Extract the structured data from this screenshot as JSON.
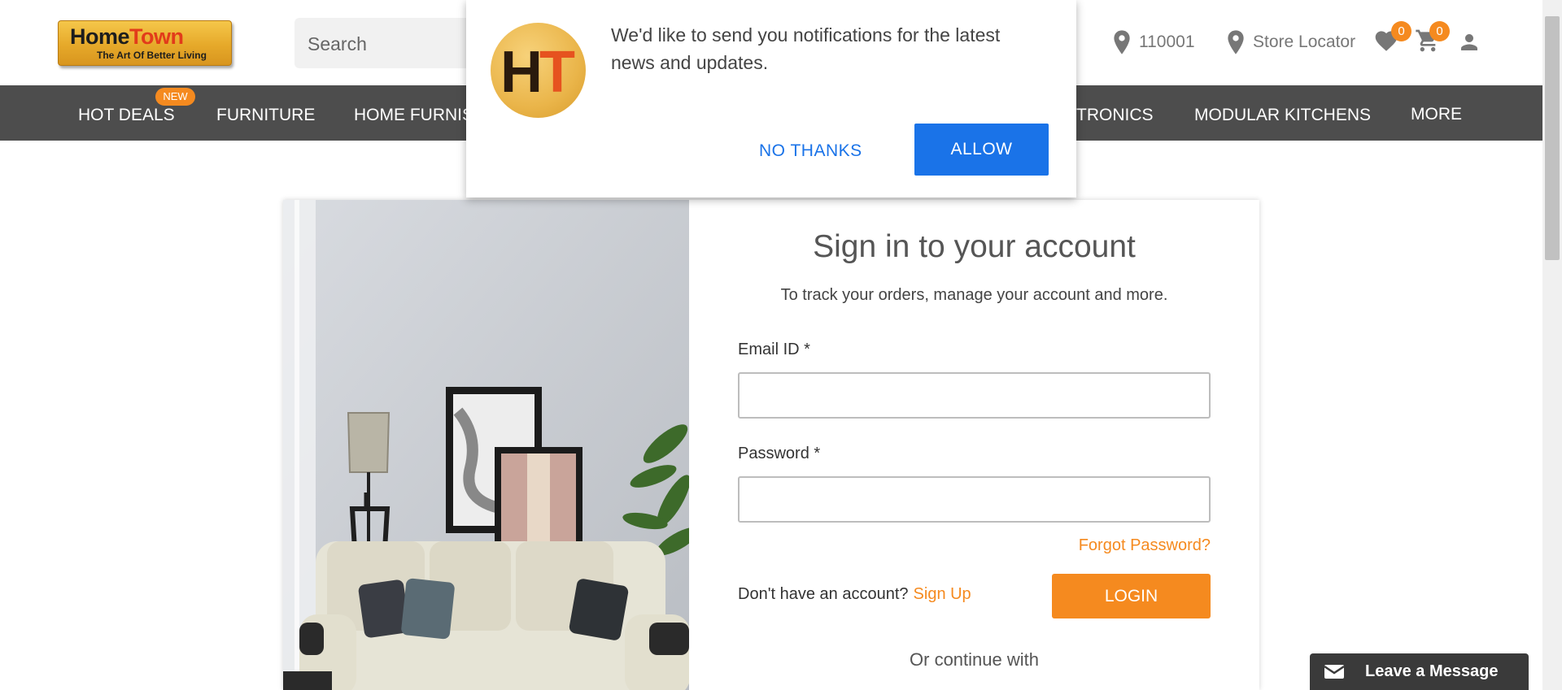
{
  "header": {
    "logo_main_home": "Home",
    "logo_main_town": "Town",
    "logo_tagline": "The Art Of Better Living",
    "search_placeholder": "Search",
    "pincode": "110001",
    "store_locator": "Store Locator",
    "wishlist_count": "0",
    "cart_count": "0",
    "icons": [
      "location-pin-icon",
      "heart-icon",
      "cart-icon",
      "user-icon"
    ]
  },
  "nav": {
    "items": [
      "HOT DEALS",
      "FURNITURE",
      "HOME FURNIS",
      "TRONICS",
      "MODULAR KITCHENS",
      "MORE"
    ],
    "new_badge": "NEW"
  },
  "login": {
    "title": "Sign in to your account",
    "subtitle": "To track your orders, manage your account and more.",
    "email_label": "Email ID *",
    "password_label": "Password *",
    "forgot": "Forgot Password?",
    "no_account": "Don't have an account?",
    "signup": "Sign Up",
    "login_button": "LOGIN",
    "or_continue": "Or continue with"
  },
  "notification": {
    "logo_h": "H",
    "logo_t": "T",
    "text": "We'd like to send you notifications for the latest news and updates.",
    "no_thanks": "NO THANKS",
    "allow": "ALLOW"
  },
  "chat": {
    "label": "Leave a Message"
  },
  "colors": {
    "accent_orange": "#f58a1f",
    "nav_bg": "#4d4d4d",
    "allow_blue": "#1a73e8"
  }
}
